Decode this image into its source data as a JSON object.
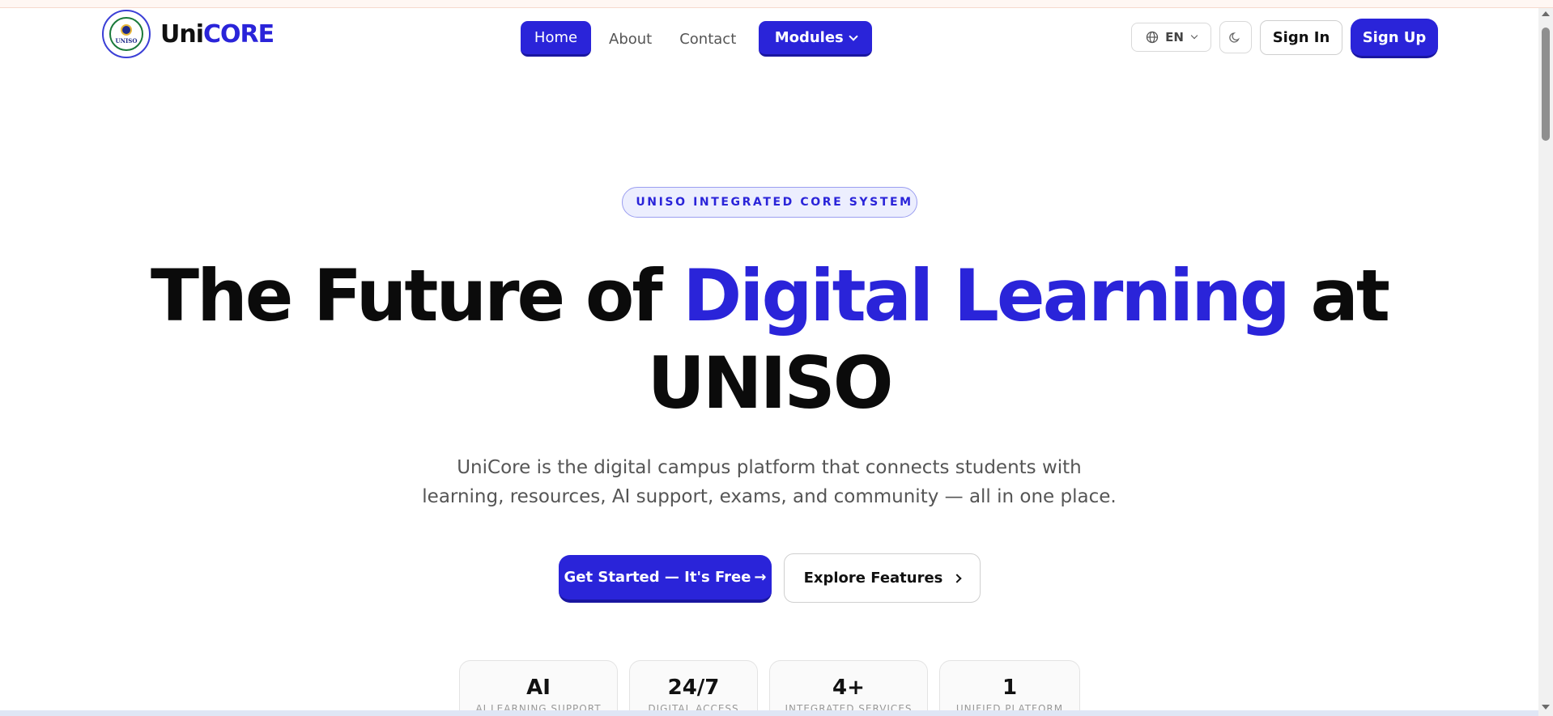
{
  "brand": {
    "name_part1": "Uni",
    "name_part2": "CORE",
    "badge_text": "UNISO"
  },
  "nav": {
    "items": [
      {
        "label": "Home",
        "active": true
      },
      {
        "label": "About",
        "active": false
      },
      {
        "label": "Contact",
        "active": false
      }
    ],
    "modules_label": "Modules"
  },
  "header_actions": {
    "language": "EN",
    "language_icon": "globe-icon",
    "theme_icon": "moon-icon",
    "sign_in": "Sign In",
    "sign_up": "Sign Up"
  },
  "hero": {
    "eyebrow": "UNISO INTEGRATED CORE SYSTEM",
    "headline_before": "The Future of ",
    "headline_accent": "Digital Learning",
    "headline_after": " at",
    "headline_line2": "UNISO",
    "subtitle_line1": "UniCore is the digital campus platform that connects students with",
    "subtitle_line2": "learning, resources, AI support, exams, and community — all in one place.",
    "primary_cta": "Get Started — It's Free",
    "secondary_cta": "Explore Features"
  },
  "stats": [
    {
      "value": "AI",
      "label": "AI LEARNING SUPPORT"
    },
    {
      "value": "24/7",
      "label": "DIGITAL ACCESS"
    },
    {
      "value": "4+",
      "label": "INTEGRATED SERVICES"
    },
    {
      "value": "1",
      "label": "UNIFIED PLATFORM"
    }
  ],
  "colors": {
    "accent": "#2a24d9",
    "text": "#0b0b0b",
    "muted": "#555555"
  }
}
